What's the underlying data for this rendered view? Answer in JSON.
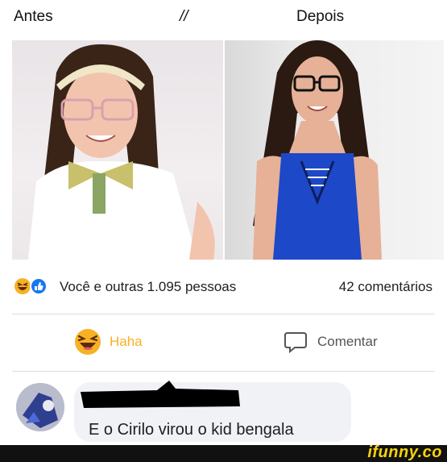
{
  "header": {
    "left_label": "Antes",
    "middle_label": "//",
    "right_label": "Depois"
  },
  "photos": {
    "left_icon": "before-photo",
    "right_icon": "after-photo"
  },
  "stats": {
    "reactions_text": "Você e outras 1.095 pessoas",
    "comments_count": "42 comentários",
    "reaction_icons": [
      "haha-icon",
      "like-icon"
    ]
  },
  "actions": {
    "haha_label": "Haha",
    "comment_label": "Comentar"
  },
  "comment": {
    "text": "E o Cirilo virou o kid bengala"
  },
  "footer": {
    "watermark": "ifunny.co"
  },
  "colors": {
    "haha_yellow": "#f7b125",
    "like_blue": "#1877f2",
    "watermark_yellow": "#f6d30a",
    "bubble_gray": "#f0f2f5"
  }
}
